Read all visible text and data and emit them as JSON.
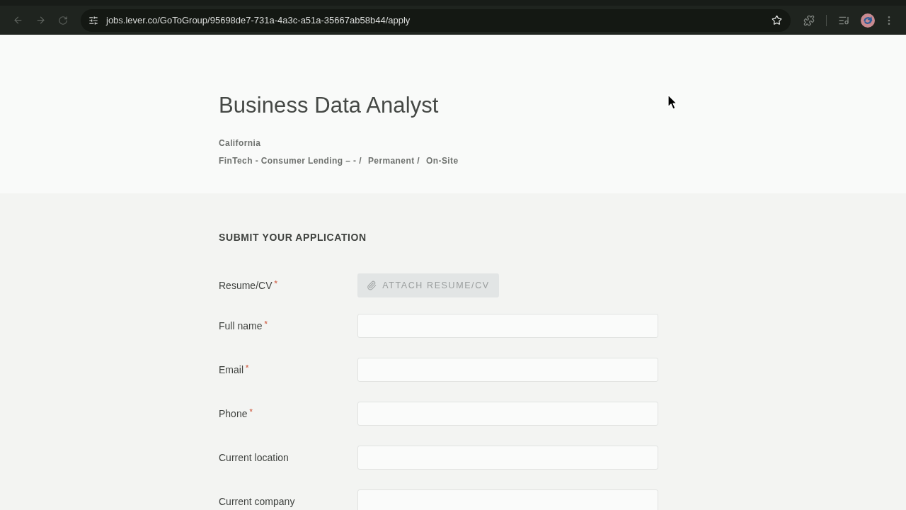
{
  "browser": {
    "url": "jobs.lever.co/GoToGroup/95698de7-731a-4a3c-a51a-35667ab58b44/apply"
  },
  "posting": {
    "title": "Business Data Analyst",
    "location": "California",
    "categories": [
      "FinTech - Consumer Lending – - /",
      "Permanent /",
      "On-Site"
    ]
  },
  "application": {
    "heading": "SUBMIT YOUR APPLICATION",
    "fields": [
      {
        "kind": "file",
        "label": "Resume/CV",
        "required_mark": "*",
        "button": "ATTACH RESUME/CV"
      },
      {
        "kind": "text",
        "label": "Full name",
        "required_mark": "*"
      },
      {
        "kind": "text",
        "label": "Email",
        "required_mark": "*"
      },
      {
        "kind": "text",
        "label": "Phone",
        "required_mark": "*"
      },
      {
        "kind": "text",
        "label": "Current location"
      },
      {
        "kind": "text",
        "label": "Current company"
      }
    ]
  }
}
